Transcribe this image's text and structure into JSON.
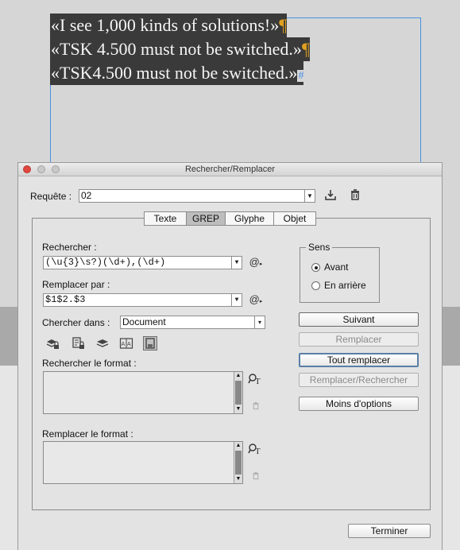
{
  "document": {
    "lines": [
      {
        "text": "«I see 1,000 kinds of solutions!»",
        "mark": "¶"
      },
      {
        "text": "«TSK 4.500 must not be switched.»",
        "mark": "¶"
      },
      {
        "text": "«TSK4.500 must not be switched.»",
        "mark": "#"
      }
    ]
  },
  "dialog": {
    "title": "Rechercher/Remplacer",
    "query_label": "Requête :",
    "query_value": "02",
    "tabs": [
      "Texte",
      "GREP",
      "Glyphe",
      "Objet"
    ],
    "selected_tab": "GREP",
    "find_label": "Rechercher :",
    "find_value": "(\\u{3}\\s?)(\\d+),(\\d+)",
    "replace_label": "Remplacer par :",
    "replace_value": "$1$2.$3",
    "search_in_label": "Chercher dans :",
    "search_in_value": "Document",
    "find_format_label": "Rechercher le format :",
    "replace_format_label": "Remplacer le format :",
    "direction": {
      "title": "Sens",
      "options": [
        "Avant",
        "En arrière"
      ],
      "selected": "Avant"
    },
    "buttons": {
      "next": "Suivant",
      "replace": "Remplacer",
      "replace_all": "Tout remplacer",
      "replace_find": "Remplacer/Rechercher",
      "fewer_options": "Moins d'options",
      "done": "Terminer"
    },
    "icons": {
      "save_query": "save-query-icon",
      "delete_query": "trash-icon",
      "special_chars": "at-sign-icon",
      "include_locked_layers": "locked-layers-icon",
      "include_locked_stories": "locked-stories-icon",
      "include_hidden_layers": "hidden-layers-icon",
      "include_master_pages": "master-pages-icon",
      "include_footnotes": "footnotes-icon",
      "specify_format": "format-icon"
    }
  }
}
